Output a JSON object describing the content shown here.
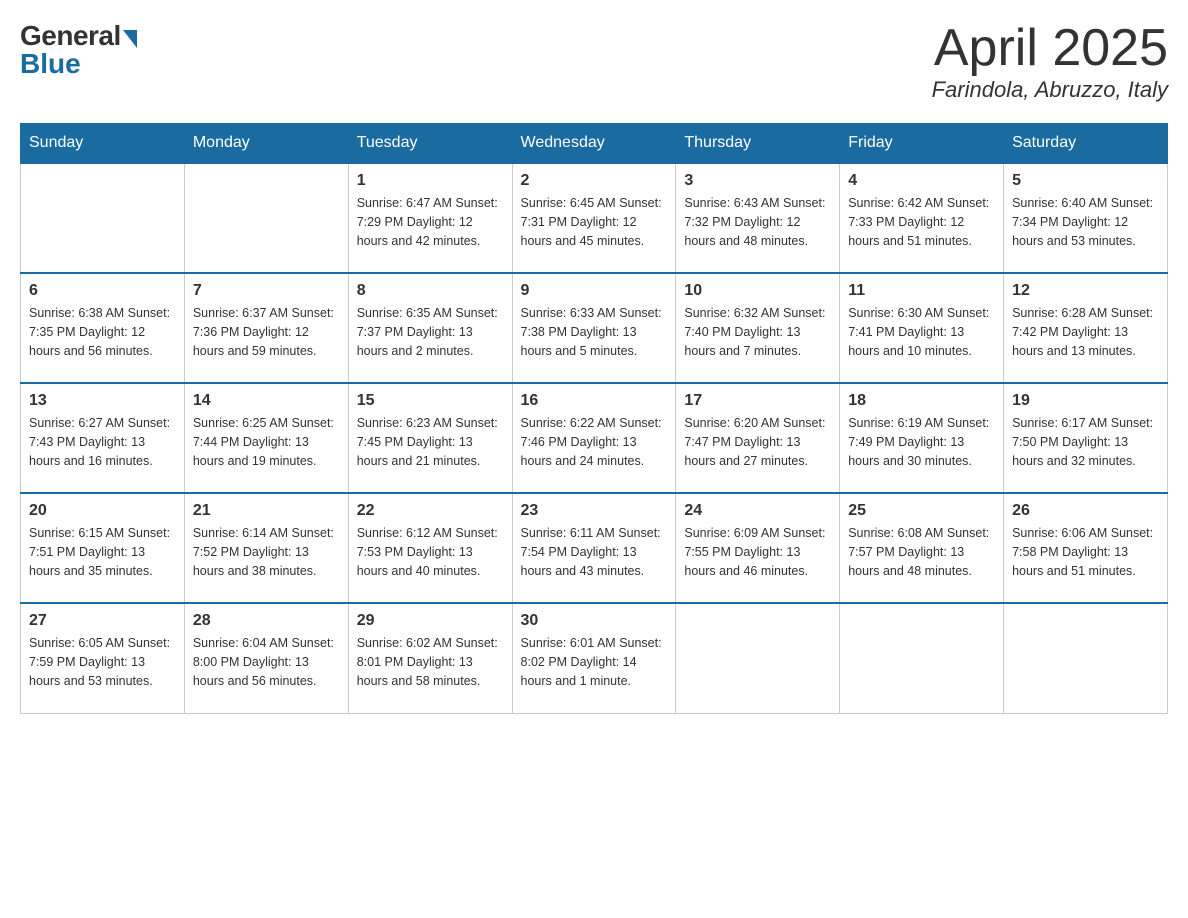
{
  "header": {
    "logo_general": "General",
    "logo_blue": "Blue",
    "month_title": "April 2025",
    "location": "Farindola, Abruzzo, Italy"
  },
  "days_of_week": [
    "Sunday",
    "Monday",
    "Tuesday",
    "Wednesday",
    "Thursday",
    "Friday",
    "Saturday"
  ],
  "weeks": [
    [
      {
        "day": "",
        "info": ""
      },
      {
        "day": "",
        "info": ""
      },
      {
        "day": "1",
        "info": "Sunrise: 6:47 AM\nSunset: 7:29 PM\nDaylight: 12 hours\nand 42 minutes."
      },
      {
        "day": "2",
        "info": "Sunrise: 6:45 AM\nSunset: 7:31 PM\nDaylight: 12 hours\nand 45 minutes."
      },
      {
        "day": "3",
        "info": "Sunrise: 6:43 AM\nSunset: 7:32 PM\nDaylight: 12 hours\nand 48 minutes."
      },
      {
        "day": "4",
        "info": "Sunrise: 6:42 AM\nSunset: 7:33 PM\nDaylight: 12 hours\nand 51 minutes."
      },
      {
        "day": "5",
        "info": "Sunrise: 6:40 AM\nSunset: 7:34 PM\nDaylight: 12 hours\nand 53 minutes."
      }
    ],
    [
      {
        "day": "6",
        "info": "Sunrise: 6:38 AM\nSunset: 7:35 PM\nDaylight: 12 hours\nand 56 minutes."
      },
      {
        "day": "7",
        "info": "Sunrise: 6:37 AM\nSunset: 7:36 PM\nDaylight: 12 hours\nand 59 minutes."
      },
      {
        "day": "8",
        "info": "Sunrise: 6:35 AM\nSunset: 7:37 PM\nDaylight: 13 hours\nand 2 minutes."
      },
      {
        "day": "9",
        "info": "Sunrise: 6:33 AM\nSunset: 7:38 PM\nDaylight: 13 hours\nand 5 minutes."
      },
      {
        "day": "10",
        "info": "Sunrise: 6:32 AM\nSunset: 7:40 PM\nDaylight: 13 hours\nand 7 minutes."
      },
      {
        "day": "11",
        "info": "Sunrise: 6:30 AM\nSunset: 7:41 PM\nDaylight: 13 hours\nand 10 minutes."
      },
      {
        "day": "12",
        "info": "Sunrise: 6:28 AM\nSunset: 7:42 PM\nDaylight: 13 hours\nand 13 minutes."
      }
    ],
    [
      {
        "day": "13",
        "info": "Sunrise: 6:27 AM\nSunset: 7:43 PM\nDaylight: 13 hours\nand 16 minutes."
      },
      {
        "day": "14",
        "info": "Sunrise: 6:25 AM\nSunset: 7:44 PM\nDaylight: 13 hours\nand 19 minutes."
      },
      {
        "day": "15",
        "info": "Sunrise: 6:23 AM\nSunset: 7:45 PM\nDaylight: 13 hours\nand 21 minutes."
      },
      {
        "day": "16",
        "info": "Sunrise: 6:22 AM\nSunset: 7:46 PM\nDaylight: 13 hours\nand 24 minutes."
      },
      {
        "day": "17",
        "info": "Sunrise: 6:20 AM\nSunset: 7:47 PM\nDaylight: 13 hours\nand 27 minutes."
      },
      {
        "day": "18",
        "info": "Sunrise: 6:19 AM\nSunset: 7:49 PM\nDaylight: 13 hours\nand 30 minutes."
      },
      {
        "day": "19",
        "info": "Sunrise: 6:17 AM\nSunset: 7:50 PM\nDaylight: 13 hours\nand 32 minutes."
      }
    ],
    [
      {
        "day": "20",
        "info": "Sunrise: 6:15 AM\nSunset: 7:51 PM\nDaylight: 13 hours\nand 35 minutes."
      },
      {
        "day": "21",
        "info": "Sunrise: 6:14 AM\nSunset: 7:52 PM\nDaylight: 13 hours\nand 38 minutes."
      },
      {
        "day": "22",
        "info": "Sunrise: 6:12 AM\nSunset: 7:53 PM\nDaylight: 13 hours\nand 40 minutes."
      },
      {
        "day": "23",
        "info": "Sunrise: 6:11 AM\nSunset: 7:54 PM\nDaylight: 13 hours\nand 43 minutes."
      },
      {
        "day": "24",
        "info": "Sunrise: 6:09 AM\nSunset: 7:55 PM\nDaylight: 13 hours\nand 46 minutes."
      },
      {
        "day": "25",
        "info": "Sunrise: 6:08 AM\nSunset: 7:57 PM\nDaylight: 13 hours\nand 48 minutes."
      },
      {
        "day": "26",
        "info": "Sunrise: 6:06 AM\nSunset: 7:58 PM\nDaylight: 13 hours\nand 51 minutes."
      }
    ],
    [
      {
        "day": "27",
        "info": "Sunrise: 6:05 AM\nSunset: 7:59 PM\nDaylight: 13 hours\nand 53 minutes."
      },
      {
        "day": "28",
        "info": "Sunrise: 6:04 AM\nSunset: 8:00 PM\nDaylight: 13 hours\nand 56 minutes."
      },
      {
        "day": "29",
        "info": "Sunrise: 6:02 AM\nSunset: 8:01 PM\nDaylight: 13 hours\nand 58 minutes."
      },
      {
        "day": "30",
        "info": "Sunrise: 6:01 AM\nSunset: 8:02 PM\nDaylight: 14 hours\nand 1 minute."
      },
      {
        "day": "",
        "info": ""
      },
      {
        "day": "",
        "info": ""
      },
      {
        "day": "",
        "info": ""
      }
    ]
  ]
}
